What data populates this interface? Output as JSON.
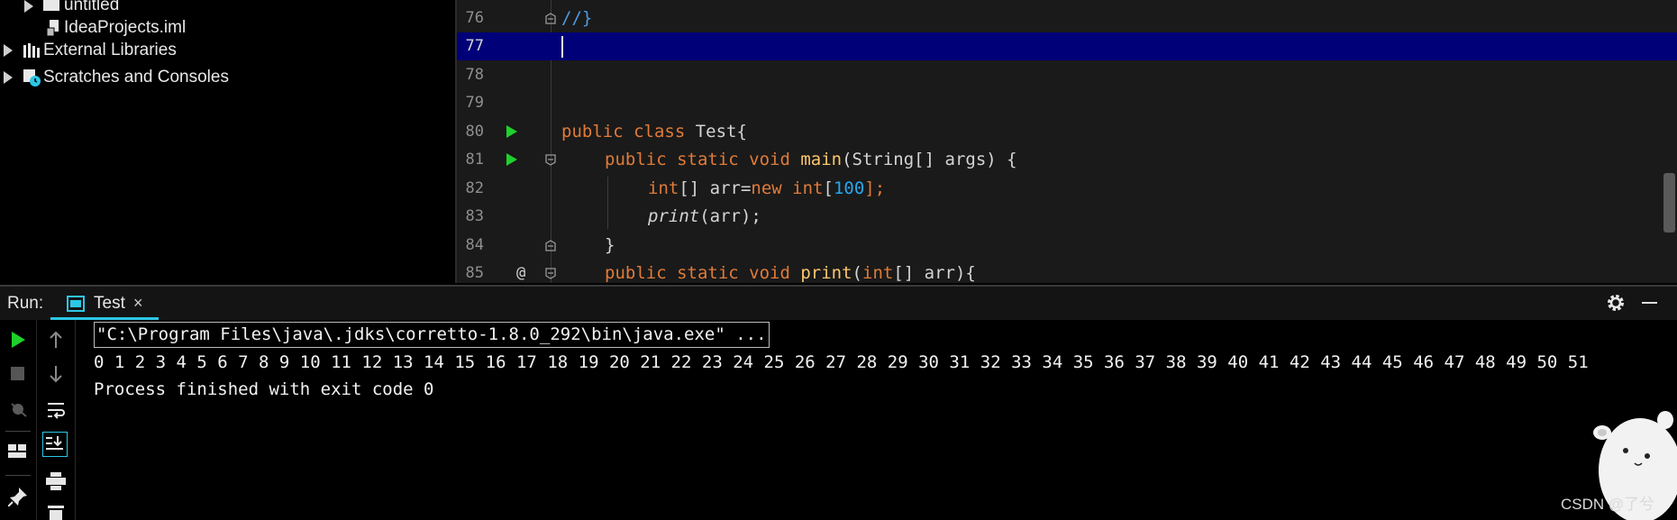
{
  "project_tree": {
    "items": [
      {
        "label": "untitled",
        "icon": "folder-icon"
      },
      {
        "label": "IdeaProjects.iml",
        "icon": "iml-file-icon"
      },
      {
        "label": "External Libraries",
        "icon": "libraries-icon"
      },
      {
        "label": "Scratches and Consoles",
        "icon": "scratches-icon"
      }
    ]
  },
  "editor": {
    "lines": [
      {
        "num": "76"
      },
      {
        "num": "77"
      },
      {
        "num": "78"
      },
      {
        "num": "79"
      },
      {
        "num": "80"
      },
      {
        "num": "81"
      },
      {
        "num": "82"
      },
      {
        "num": "83"
      },
      {
        "num": "84"
      },
      {
        "num": "85",
        "gutter_mark": "@"
      }
    ],
    "tokens": {
      "l76": "//}",
      "l80_kw": "public class ",
      "l80_rest": "Test{",
      "l81_kw": "public static void ",
      "l81_fn": "main",
      "l81_rest": "(String[] args) {",
      "l82_kw1": "int",
      "l82_mid": "[] arr=",
      "l82_kw2": "new int",
      "l82_open": "[",
      "l82_num": "100",
      "l82_close": "];",
      "l83_fn": "print",
      "l83_rest": "(arr);",
      "l84": "}",
      "l85_kw": "public static void ",
      "l85_fn": "print",
      "l85_open": "(",
      "l85_kw2": "int",
      "l85_rest": "[] arr){"
    }
  },
  "run": {
    "label": "Run:",
    "tab_label": "Test",
    "tab_close": "×",
    "command": "\"C:\\Program Files\\java\\.jdks\\corretto-1.8.0_292\\bin\\java.exe\" ...",
    "output": "0 1 2 3 4 5 6 7 8 9 10 11 12 13 14 15 16 17 18 19 20 21 22 23 24 25 26 27 28 29 30 31 32 33 34 35 36 37 38 39 40 41 42 43 44 45 46 47 48 49 50 51",
    "exit_message": "Process finished with exit code 0"
  },
  "watermark": "CSDN @了兮",
  "colors": {
    "accent": "#2cc7e6",
    "run_green": "#1fd12c",
    "keyword": "#e07b39",
    "function": "#ffc66d",
    "number": "#28a6f0",
    "current_line": "#000078"
  }
}
